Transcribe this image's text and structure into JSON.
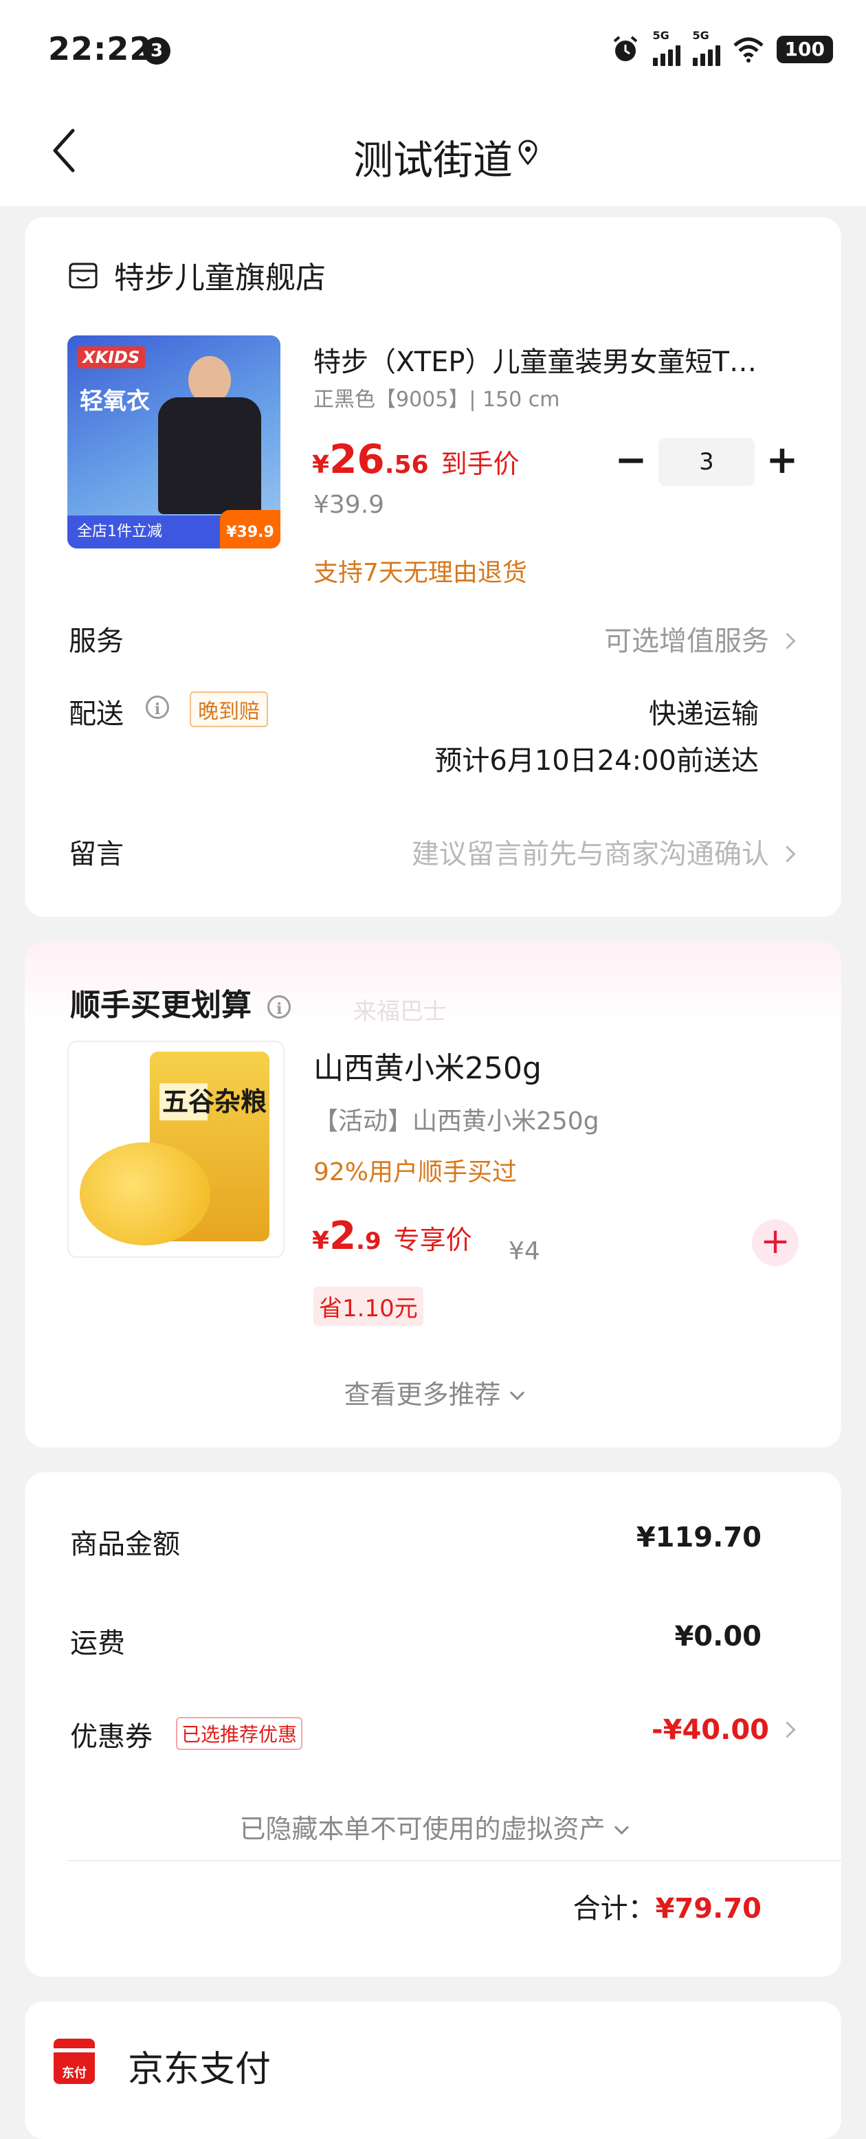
{
  "status_bar": {
    "time": "22:22",
    "notifications": "3",
    "network1": "5G",
    "network2": "5G",
    "battery": "100"
  },
  "nav": {
    "title": "测试街道"
  },
  "order": {
    "shop_name": "特步儿童旗舰店",
    "product": {
      "title": "特步（XTEP）儿童童装男女童短T…",
      "spec": "正黑色【9005】| 150 cm",
      "currency": "¥",
      "price_int": "26",
      "price_dec": ".56",
      "price_label": "到手价",
      "original_price": "¥39.9",
      "return_policy": "支持7天无理由退货",
      "quantity": "3",
      "thumb_logo": "XKIDS",
      "thumb_tag": "轻氧衣",
      "thumb_footer": "全店1件立减",
      "thumb_price": "¥39.9"
    },
    "service": {
      "label": "服务",
      "value": "可选增值服务"
    },
    "delivery": {
      "label": "配送",
      "badge": "晚到赔",
      "method": "快递运输",
      "eta": "预计6月10日24:00前送达"
    },
    "message": {
      "label": "留言",
      "placeholder": "建议留言前先与商家沟通确认"
    }
  },
  "upsell": {
    "title": "顺手买更划算",
    "watermark": "来福巴士",
    "item": {
      "title": "山西黄小米250g",
      "subtitle": "【活动】山西黄小米250g",
      "hot": "92%用户顺手买过",
      "currency": "¥",
      "price_int": "2",
      "price_dec": ".9",
      "price_label": "专享价",
      "original_price": "¥4",
      "save": "省1.10元",
      "thumb_label": "五谷杂粮"
    },
    "more": "查看更多推荐"
  },
  "summary": {
    "goods_label": "商品金额",
    "goods_value": "¥119.70",
    "shipping_label": "运费",
    "shipping_value": "¥0.00",
    "coupon_label": "优惠券",
    "coupon_badge": "已选推荐优惠",
    "coupon_value": "-¥40.00",
    "hidden_assets": "已隐藏本单不可使用的虚拟资产",
    "total_label": "合计：",
    "total_value": "¥79.70"
  },
  "payment": {
    "name": "京东支付",
    "icon_text": "东付"
  },
  "colors": {
    "accent_red": "#e31b1b",
    "orange": "#d8781c",
    "background": "#f2f2f2"
  }
}
